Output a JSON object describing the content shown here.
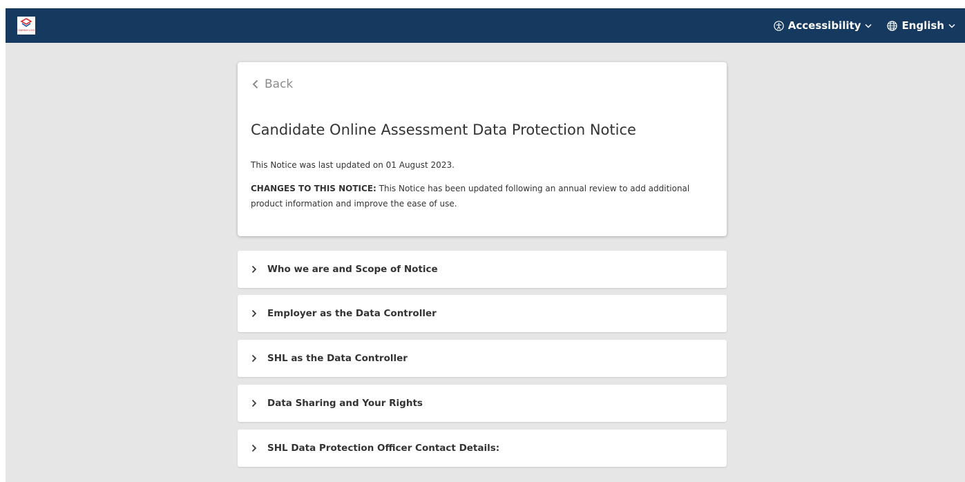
{
  "header": {
    "logo_text": "COMPANY LOGO",
    "accessibility_label": "Accessibility",
    "language_label": "English",
    "background_color": "#163a5f"
  },
  "notice": {
    "back_label": "Back",
    "title": "Candidate Online Assessment Data Protection Notice",
    "last_updated": "This Notice was last updated on 01 August 2023.",
    "changes_heading": "CHANGES TO THIS NOTICE:",
    "changes_text": " This Notice has been updated following an annual review to add additional product information and improve the ease of use."
  },
  "sections": [
    {
      "label": "Who we are and Scope of Notice"
    },
    {
      "label": "Employer as the Data Controller"
    },
    {
      "label": "SHL as the Data Controller"
    },
    {
      "label": "Data Sharing and Your Rights"
    },
    {
      "label": "SHL Data Protection Officer Contact Details:"
    }
  ],
  "icons": {
    "back": "chevron-left-icon",
    "section": "chevron-right-icon",
    "accessibility": "accessibility-icon",
    "language": "globe-icon",
    "dropdown": "chevron-down-icon"
  }
}
